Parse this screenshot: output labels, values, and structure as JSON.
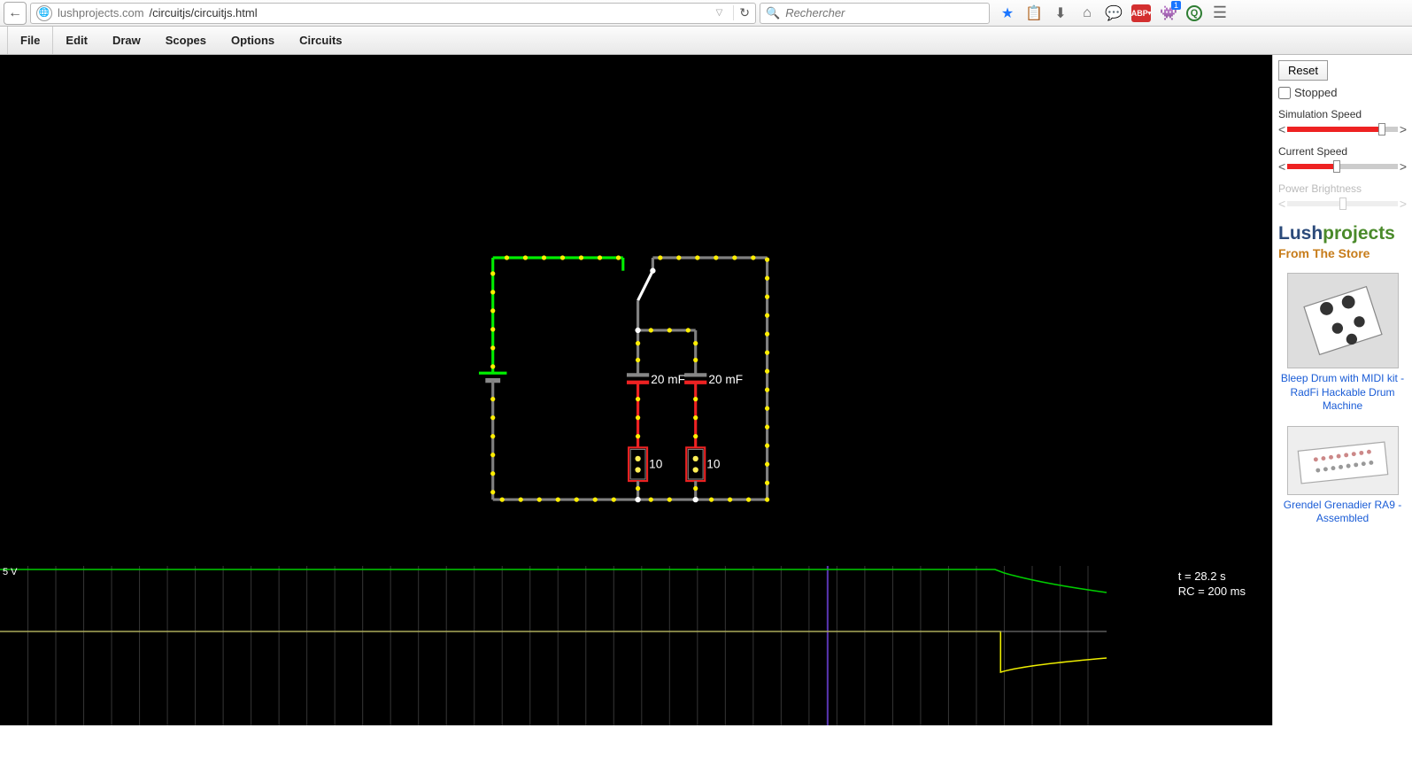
{
  "browser": {
    "url_host": "lushprojects.com",
    "url_path": "/circuitjs/circuitjs.html",
    "search_placeholder": "Rechercher",
    "toolbar_icons": {
      "abp_label": "ABP",
      "badge_number": "1"
    }
  },
  "menubar": [
    "File",
    "Edit",
    "Draw",
    "Scopes",
    "Options",
    "Circuits"
  ],
  "sidebar": {
    "reset_label": "Reset",
    "stopped_label": "Stopped",
    "stopped_checked": false,
    "sliders": [
      {
        "label": "Simulation Speed",
        "value_pct": 86,
        "enabled": true
      },
      {
        "label": "Current Speed",
        "value_pct": 45,
        "enabled": true
      },
      {
        "label": "Power Brightness",
        "value_pct": 50,
        "enabled": false
      }
    ],
    "logo_part1": "Lush",
    "logo_part2": "projects",
    "store_heading": "From The Store",
    "products": [
      {
        "name": "Bleep Drum with MIDI kit - RadFi Hackable Drum Machine"
      },
      {
        "name": "Grendel Grenadier RA9 - Assembled"
      }
    ]
  },
  "circuit": {
    "component_labels": {
      "cap1": "20 mF",
      "cap2": "20 mF",
      "res1": "10",
      "res2": "10"
    }
  },
  "scope": {
    "y_label": "5 V",
    "time_label": "t = 28.2 s",
    "rc_label": "RC = 200 ms"
  }
}
